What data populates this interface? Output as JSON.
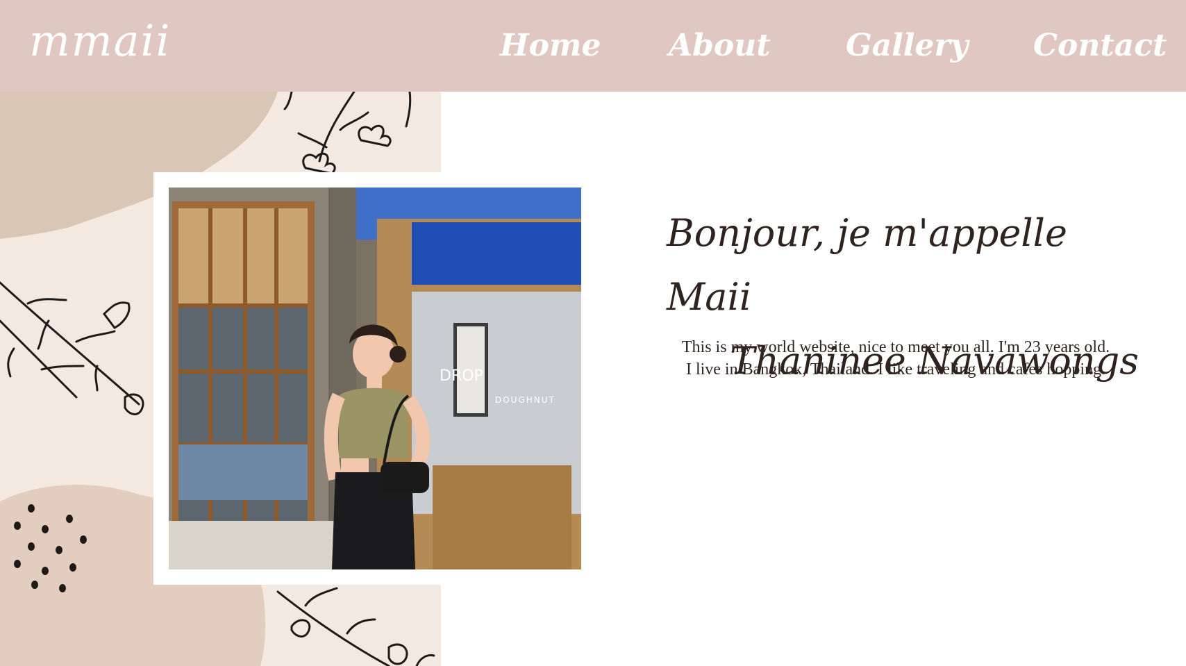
{
  "site": {
    "logo_text": "mmaii"
  },
  "nav": {
    "items": [
      {
        "label": "Home"
      },
      {
        "label": "About"
      },
      {
        "label": "Gallery"
      },
      {
        "label": "Contact"
      }
    ]
  },
  "intro": {
    "greeting_line1": "Bonjour, je m'appelle Maii",
    "greeting_line2": "Thaninee Navawongs",
    "bio_line1": "This is my world website, nice to meet you all. I'm 23 years old.",
    "bio_line2": "I live in Bangkok, Thailand. I like traveling and cafes hopping."
  },
  "photo": {
    "sign_text": "DROP",
    "sign_subtext": "DOUGHNUT"
  },
  "colors": {
    "header_bg": "#e0c7c1",
    "panel_bg": "#f4e9e1",
    "blob": "#d9c6b4",
    "text_dark": "#2f2320"
  }
}
